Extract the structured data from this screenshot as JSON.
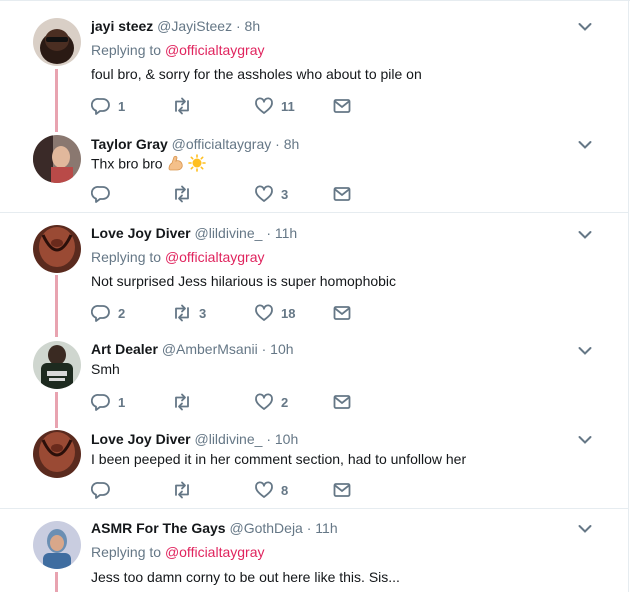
{
  "replying_prefix": "Replying to",
  "tweets": [
    {
      "name": "jayi steez",
      "handle": "@JayiSteez",
      "time": "8h",
      "replying_to": "@officialtaygray",
      "text": "foul bro, & sorry for the assholes who about to pile on",
      "reply_count": "1",
      "retweet_count": "",
      "like_count": "11"
    },
    {
      "name": "Taylor Gray",
      "handle": "@officialtaygray",
      "time": "8h",
      "replying_to": "",
      "text": "Thx bro bro",
      "emojis": [
        "flexed-biceps",
        "sun"
      ],
      "reply_count": "",
      "retweet_count": "",
      "like_count": "3"
    },
    {
      "name": "Love Joy Diver",
      "handle": "@lildivine_",
      "time": "11h",
      "replying_to": "@officialtaygray",
      "text": "Not surprised Jess hilarious is super homophobic",
      "reply_count": "2",
      "retweet_count": "3",
      "like_count": "18"
    },
    {
      "name": "Art Dealer",
      "handle": "@AmberMsanii",
      "time": "10h",
      "replying_to": "",
      "text": "Smh",
      "reply_count": "1",
      "retweet_count": "",
      "like_count": "2"
    },
    {
      "name": "Love Joy Diver",
      "handle": "@lildivine_",
      "time": "10h",
      "replying_to": "",
      "text": "I been peeped it in her comment section, had to unfollow her",
      "reply_count": "",
      "retweet_count": "",
      "like_count": "8"
    },
    {
      "name": "ASMR For The Gays",
      "handle": "@GothDeja",
      "time": "11h",
      "replying_to": "@officialtaygray",
      "text": "Jess too damn corny to be out here like this. Sis...",
      "reply_count": "",
      "retweet_count": "",
      "like_count": ""
    }
  ],
  "colors": {
    "mention": "#e0245e",
    "thread_line": "#e8a3b0",
    "secondary_text": "#657786",
    "separator": "#e6ecf0"
  },
  "icons": [
    "reply-icon",
    "retweet-icon",
    "like-icon",
    "direct-message-icon",
    "chevron-down-icon"
  ]
}
